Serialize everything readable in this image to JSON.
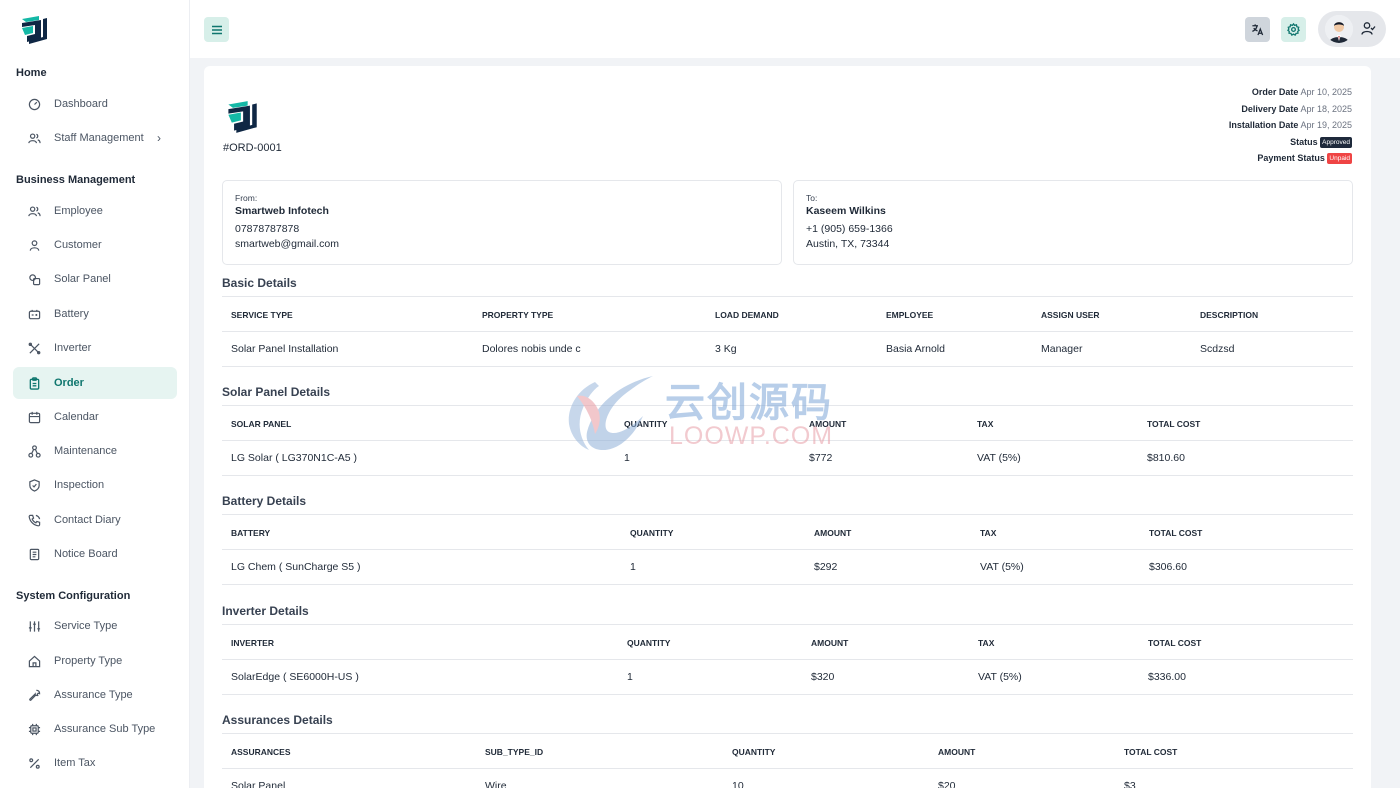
{
  "sidebar": {
    "sections": {
      "home": "Home",
      "business": "Business Management",
      "system": "System Configuration"
    },
    "items": [
      {
        "label": "Dashboard",
        "icon": "dashboard-icon"
      },
      {
        "label": "Staff Management",
        "icon": "users-icon"
      },
      {
        "label": "Employee",
        "icon": "users-icon"
      },
      {
        "label": "Customer",
        "icon": "user-icon"
      },
      {
        "label": "Solar Panel",
        "icon": "solar-panel-icon"
      },
      {
        "label": "Battery",
        "icon": "battery-icon"
      },
      {
        "label": "Inverter",
        "icon": "inverter-icon"
      },
      {
        "label": "Order",
        "icon": "clipboard-icon"
      },
      {
        "label": "Calendar",
        "icon": "calendar-icon"
      },
      {
        "label": "Maintenance",
        "icon": "hierarchy-icon"
      },
      {
        "label": "Inspection",
        "icon": "shield-icon"
      },
      {
        "label": "Contact Diary",
        "icon": "phone-icon"
      },
      {
        "label": "Notice Board",
        "icon": "notice-icon"
      },
      {
        "label": "Service Type",
        "icon": "sliders-icon"
      },
      {
        "label": "Property Type",
        "icon": "home-icon"
      },
      {
        "label": "Assurance Type",
        "icon": "wrench-icon"
      },
      {
        "label": "Assurance Sub Type",
        "icon": "chip-icon"
      },
      {
        "label": "Item Tax",
        "icon": "percent-icon"
      }
    ]
  },
  "invoice": {
    "order_no": "#ORD-0001",
    "meta": {
      "order_date_label": "Order Date",
      "order_date": "Apr 10, 2025",
      "delivery_date_label": "Delivery Date",
      "delivery_date": "Apr 18, 2025",
      "installation_date_label": "Installation Date",
      "installation_date": "Apr 19, 2025",
      "status_label": "Status",
      "status": "Approved",
      "payment_status_label": "Payment Status",
      "payment_status": "Unpaid"
    },
    "from": {
      "label": "From:",
      "name": "Smartweb Infotech",
      "phone": "07878787878",
      "email": "smartweb@gmail.com"
    },
    "to": {
      "label": "To:",
      "name": "Kaseem Wilkins",
      "phone": "+1 (905) 659-1366",
      "address": "Austin, TX, 73344"
    }
  },
  "basic": {
    "title": "Basic Details",
    "headers": [
      "SERVICE TYPE",
      "PROPERTY TYPE",
      "LOAD DEMAND",
      "EMPLOYEE",
      "ASSIGN USER",
      "DESCRIPTION"
    ],
    "row": [
      "Solar Panel Installation",
      "Dolores nobis unde c",
      "3 Kg",
      "Basia Arnold",
      "Manager",
      "Scdzsd"
    ]
  },
  "solar": {
    "title": "Solar Panel Details",
    "headers": [
      "SOLAR PANEL",
      "QUANTITY",
      "AMOUNT",
      "TAX",
      "TOTAL COST"
    ],
    "row": [
      "LG Solar ( LG370N1C-A5 )",
      "1",
      "$772",
      "VAT (5%)",
      "$810.60"
    ]
  },
  "battery": {
    "title": "Battery Details",
    "headers": [
      "BATTERY",
      "QUANTITY",
      "AMOUNT",
      "TAX",
      "TOTAL COST"
    ],
    "row": [
      "LG Chem ( SunCharge S5 )",
      "1",
      "$292",
      "VAT (5%)",
      "$306.60"
    ]
  },
  "inverter": {
    "title": "Inverter Details",
    "headers": [
      "INVERTER",
      "QUANTITY",
      "AMOUNT",
      "TAX",
      "TOTAL COST"
    ],
    "row": [
      "SolarEdge ( SE6000H-US )",
      "1",
      "$320",
      "VAT (5%)",
      "$336.00"
    ]
  },
  "assurances": {
    "title": "Assurances Details",
    "headers": [
      "ASSURANCES",
      "SUB_TYPE_ID",
      "QUANTITY",
      "AMOUNT",
      "TOTAL COST"
    ],
    "row": [
      "Solar Panel",
      "Wire",
      "10",
      "$20",
      "$3"
    ]
  },
  "watermark": {
    "cn": "云创源码",
    "en": "LOOWP.COM"
  },
  "colors": {
    "accent": "#0f766e",
    "accent_bg": "#e6f4f1",
    "approved": "#1e293b",
    "unpaid": "#ef4444"
  }
}
